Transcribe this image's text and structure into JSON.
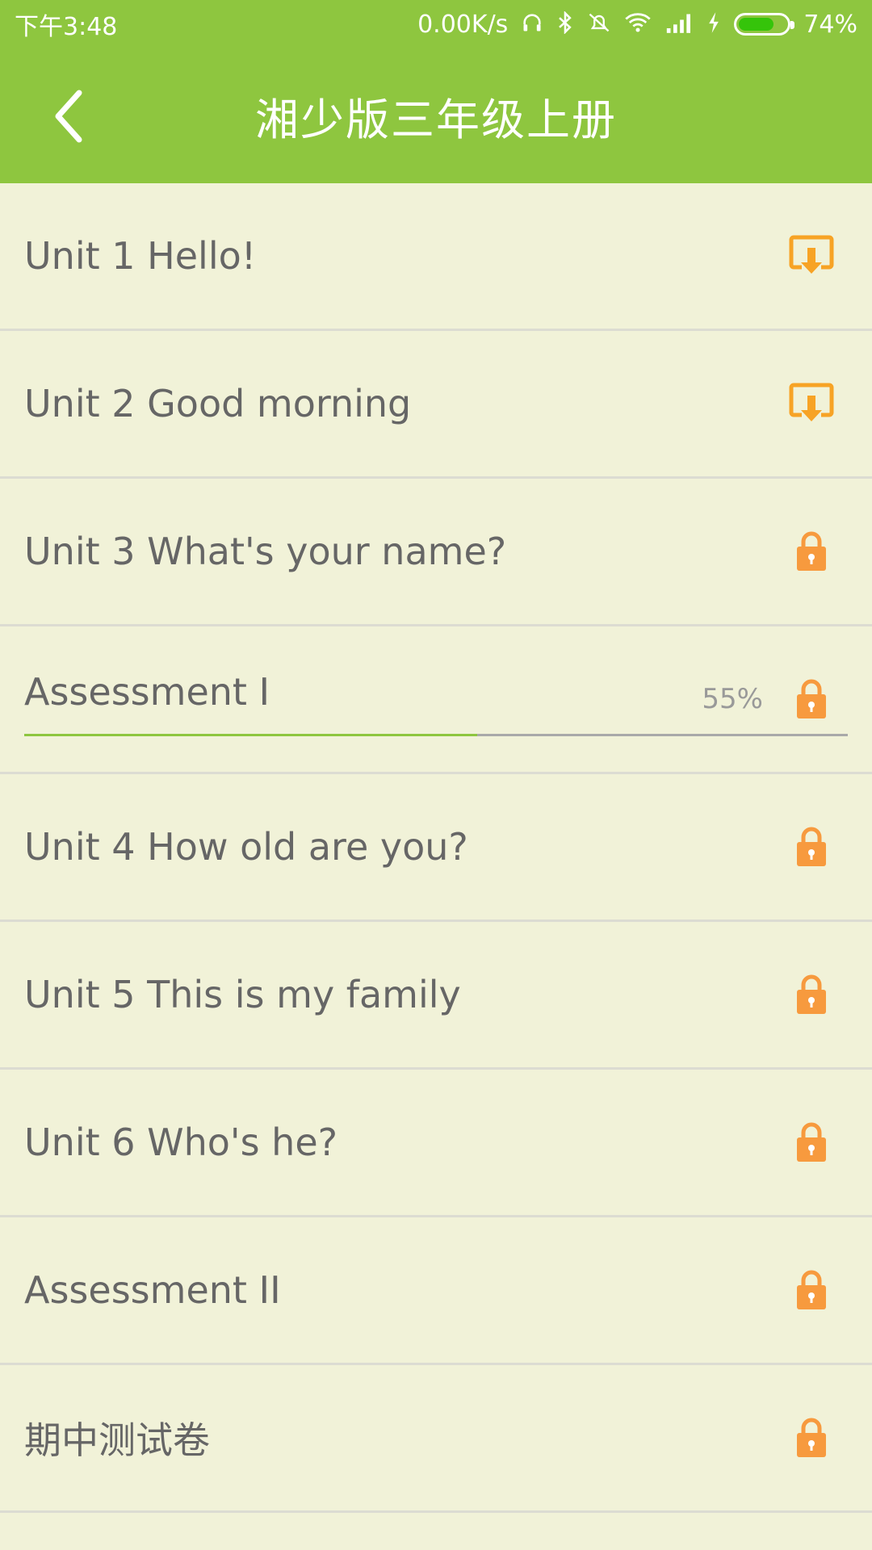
{
  "status_bar": {
    "time": "下午3:48",
    "net_speed": "0.00K/s",
    "battery_percent": "74%",
    "battery_level": 0.74,
    "icons": [
      "headset-icon",
      "bluetooth-icon",
      "vibrate-icon",
      "wifi-icon",
      "signal-icon",
      "charging-icon"
    ]
  },
  "app_bar": {
    "title": "湘少版三年级上册",
    "back_icon": "chevron-left-icon"
  },
  "colors": {
    "header_green": "#8ec63f",
    "background": "#f1f2d8",
    "icon_orange": "#f7a325",
    "lock_orange": "#f79a3e",
    "text_gray": "#666666"
  },
  "units": [
    {
      "label": "Unit 1 Hello!",
      "icon": "download-icon"
    },
    {
      "label": "Unit 2 Good morning",
      "icon": "download-icon"
    },
    {
      "label": "Unit 3 What's your name?",
      "icon": "lock-icon"
    },
    {
      "label": "Assessment I",
      "icon": "lock-icon",
      "progress_text": "55%",
      "progress": 0.55
    },
    {
      "label": "Unit 4 How old are you?",
      "icon": "lock-icon"
    },
    {
      "label": "Unit 5 This is my family",
      "icon": "lock-icon"
    },
    {
      "label": "Unit 6 Who's he?",
      "icon": "lock-icon"
    },
    {
      "label": "Assessment II",
      "icon": "lock-icon"
    },
    {
      "label": "期中测试卷",
      "icon": "lock-icon"
    }
  ]
}
